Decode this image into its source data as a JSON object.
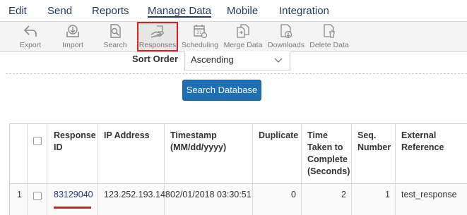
{
  "menu": {
    "items": [
      "Edit",
      "Send",
      "Reports",
      "Manage Data",
      "Mobile",
      "Integration"
    ],
    "active": "Manage Data"
  },
  "toolbar": {
    "export": "Export",
    "import": "Import",
    "search": "Search",
    "responses": "Responses",
    "scheduling": "Scheduling",
    "merge_data": "Merge Data",
    "downloads": "Downloads",
    "delete_data": "Delete Data"
  },
  "sort": {
    "label": "Sort Order",
    "value": "Ascending"
  },
  "search_button": "Search Database",
  "table": {
    "headers": {
      "response_id": "Response ID",
      "ip": "IP Address",
      "timestamp": "Timestamp (MM/dd/yyyy)",
      "duplicate": "Duplicate",
      "time_taken": "Time Taken to Complete (Seconds)",
      "seq": "Seq. Number",
      "external": "External Reference"
    },
    "rows": [
      {
        "index": "1",
        "response_id": "83129040",
        "ip": "123.252.193.148",
        "timestamp": "02/01/2018 03:30:51",
        "duplicate": "0",
        "time_taken": "2",
        "seq": "1",
        "external": "test_response"
      }
    ]
  },
  "colors": {
    "menu_text": "#1e3a5f",
    "highlight_red": "#d81f1f",
    "button_blue": "#1f6fb5"
  }
}
